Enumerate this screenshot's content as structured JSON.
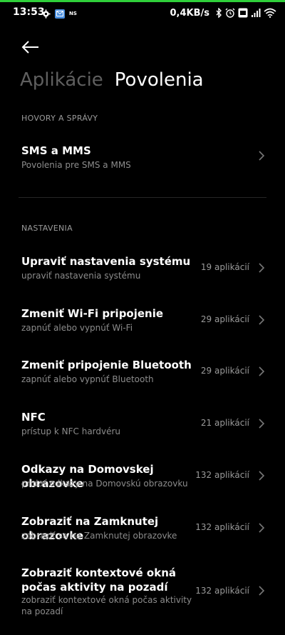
{
  "status_bar": {
    "time": "13:53",
    "ns_label": "NS",
    "speed": "0,4KB/s",
    "icons": [
      "gear-icon",
      "mail-icon",
      "bluetooth-icon",
      "alarm-icon",
      "volte-icon",
      "signal-icon",
      "wifi-icon"
    ],
    "accent_color": "#2fcf3a"
  },
  "header": {
    "back_icon": "back-arrow-icon",
    "tabs": [
      {
        "label": "Aplikácie",
        "active": false
      },
      {
        "label": "Povolenia",
        "active": true
      }
    ]
  },
  "sections": [
    {
      "header": "HOVORY A SPRÁVY",
      "items": [
        {
          "title": "SMS a MMS",
          "subtitle": "Povolenia pre SMS a MMS",
          "count": ""
        }
      ]
    },
    {
      "header": "NASTAVENIA",
      "items": [
        {
          "title": "Upraviť nastavenia systému",
          "subtitle": "upraviť nastavenia systému",
          "count": "19 aplikácií"
        },
        {
          "title": "Zmeniť Wi-Fi pripojenie",
          "subtitle": "zapnúť alebo vypnúť Wi-Fi",
          "count": "29 aplikácií"
        },
        {
          "title": "Zmeniť pripojenie Bluetooth",
          "subtitle": "zapnúť alebo vypnúť Bluetooth",
          "count": "29 aplikácií"
        },
        {
          "title": "NFC",
          "subtitle": "prístup k NFC hardvéru",
          "count": "21 aplikácií"
        },
        {
          "title": "Odkazy na Domovskej obrazovke",
          "subtitle": "pridať odkazy na Domovskú obrazovku",
          "count": "132 aplikácií"
        },
        {
          "title": "Zobraziť na Zamknutej obrazovke",
          "subtitle": "zobraziť sa na Zamknutej obrazovke",
          "count": "132 aplikácií"
        },
        {
          "title": "Zobraziť kontextové okná počas aktivity na pozadí",
          "subtitle": "zobraziť kontextové okná počas aktivity na pozadí",
          "count": "132 aplikácií"
        }
      ]
    }
  ]
}
